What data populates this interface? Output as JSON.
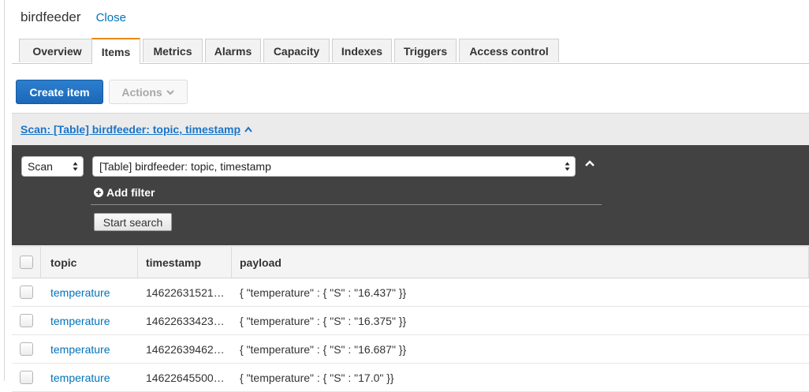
{
  "header": {
    "table_name": "birdfeeder",
    "close_label": "Close"
  },
  "tabs": [
    {
      "label": "Overview",
      "active": false
    },
    {
      "label": "Items",
      "active": true
    },
    {
      "label": "Metrics",
      "active": false
    },
    {
      "label": "Alarms",
      "active": false
    },
    {
      "label": "Capacity",
      "active": false
    },
    {
      "label": "Indexes",
      "active": false
    },
    {
      "label": "Triggers",
      "active": false
    },
    {
      "label": "Access control",
      "active": false
    }
  ],
  "toolbar": {
    "create_label": "Create item",
    "actions_label": "Actions"
  },
  "scan_bar": {
    "link_text": "Scan: [Table] birdfeeder: topic, timestamp"
  },
  "search": {
    "mode_value": "Scan",
    "target_value": "[Table] birdfeeder: topic, timestamp",
    "add_filter_label": "Add filter",
    "start_label": "Start search"
  },
  "grid": {
    "columns": [
      "topic",
      "timestamp",
      "payload"
    ],
    "rows": [
      {
        "topic": "temperature",
        "timestamp": "14622631521…",
        "payload": "{ \"temperature\" : { \"S\" : \"16.437\" }}"
      },
      {
        "topic": "temperature",
        "timestamp": "14622633423…",
        "payload": "{ \"temperature\" : { \"S\" : \"16.375\" }}"
      },
      {
        "topic": "temperature",
        "timestamp": "14622639462…",
        "payload": "{ \"temperature\" : { \"S\" : \"16.687\" }}"
      },
      {
        "topic": "temperature",
        "timestamp": "14622645500…",
        "payload": "{ \"temperature\" : { \"S\" : \"17.0\" }}"
      }
    ]
  },
  "colors": {
    "accent_blue": "#0073bb",
    "active_tab": "#e88a1a",
    "panel_dark": "#424242",
    "primary_button": "#1b68b8"
  }
}
